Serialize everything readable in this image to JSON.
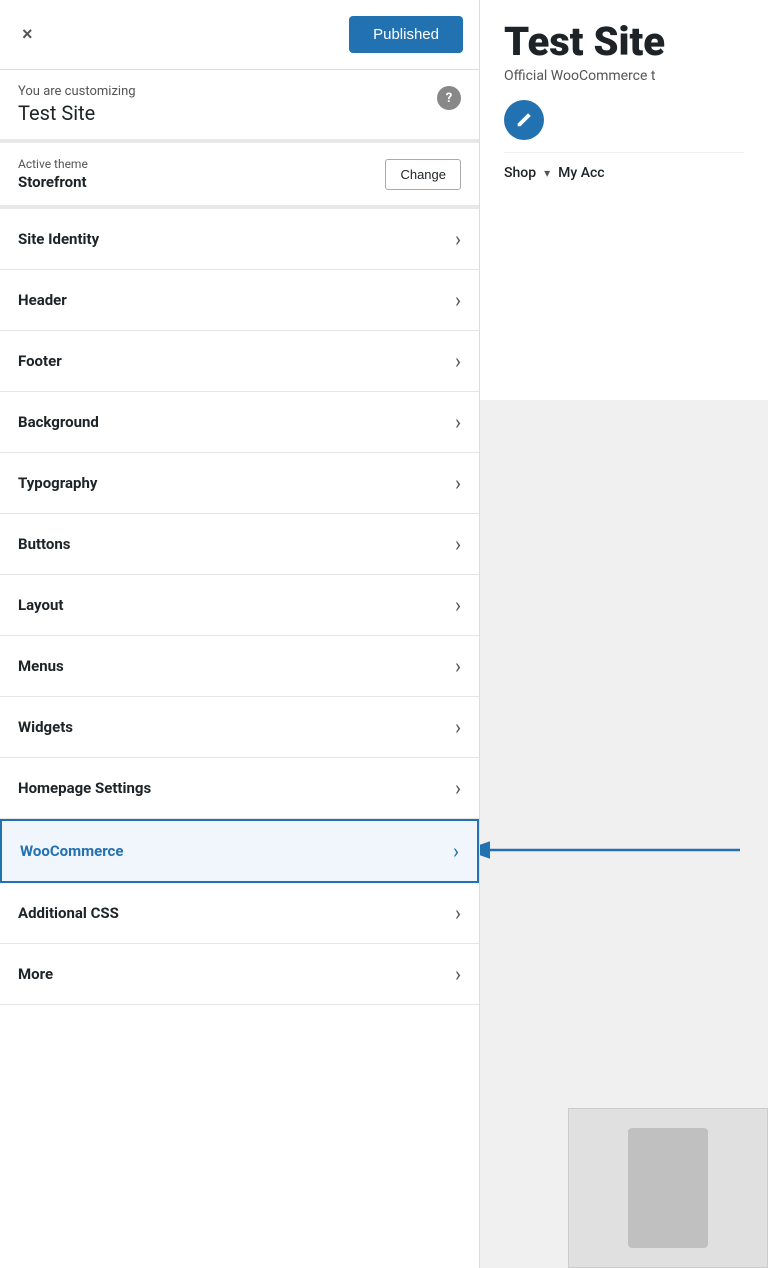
{
  "topBar": {
    "closeLabel": "×",
    "publishedLabel": "Published"
  },
  "customizing": {
    "prefixLabel": "You are customizing",
    "siteName": "Test Site",
    "helpIcon": "?"
  },
  "theme": {
    "themeLabel": "Active theme",
    "themeName": "Storefront",
    "changeLabel": "Change"
  },
  "menuItems": [
    {
      "id": "site-identity",
      "label": "Site Identity",
      "active": false
    },
    {
      "id": "header",
      "label": "Header",
      "active": false
    },
    {
      "id": "footer",
      "label": "Footer",
      "active": false
    },
    {
      "id": "background",
      "label": "Background",
      "active": false
    },
    {
      "id": "typography",
      "label": "Typography",
      "active": false
    },
    {
      "id": "buttons",
      "label": "Buttons",
      "active": false
    },
    {
      "id": "layout",
      "label": "Layout",
      "active": false
    },
    {
      "id": "menus",
      "label": "Menus",
      "active": false
    },
    {
      "id": "widgets",
      "label": "Widgets",
      "active": false
    },
    {
      "id": "homepage-settings",
      "label": "Homepage Settings",
      "active": false
    },
    {
      "id": "woocommerce",
      "label": "WooCommerce",
      "active": true
    },
    {
      "id": "additional-css",
      "label": "Additional CSS",
      "active": false
    },
    {
      "id": "more",
      "label": "More",
      "active": false
    }
  ],
  "preview": {
    "siteTitle": "Test Site",
    "siteTagline": "Official WooCommerce t",
    "navItems": [
      {
        "label": "Shop"
      },
      {
        "label": "▾"
      },
      {
        "label": "My Acc"
      }
    ]
  }
}
